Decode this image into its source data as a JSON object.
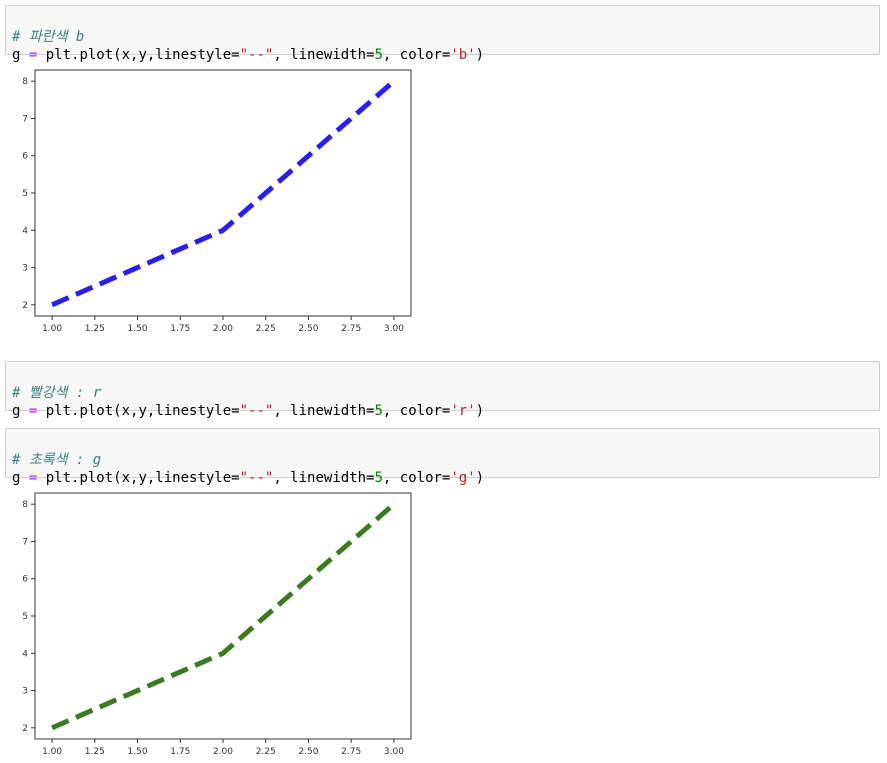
{
  "cells": [
    {
      "comment": "# 파란색 b",
      "code": {
        "var": "g",
        "assign": " = ",
        "call": "plt.plot(x,y,linestyle=",
        "linestyle_value": "\"--\"",
        "mid": ", linewidth=",
        "linewidth_value": "5",
        "mid2": ", color=",
        "color_value": "'b'",
        "end": ")"
      }
    },
    {
      "comment": "# 빨강색 : r",
      "code": {
        "var": "g",
        "assign": " = ",
        "call": "plt.plot(x,y,linestyle=",
        "linestyle_value": "\"--\"",
        "mid": ", linewidth=",
        "linewidth_value": "5",
        "mid2": ", color=",
        "color_value": "'r'",
        "end": ")"
      }
    },
    {
      "comment": "# 초록색 : g",
      "code": {
        "var": "g",
        "assign": " = ",
        "call": "plt.plot(x,y,linestyle=",
        "linestyle_value": "\"--\"",
        "mid": ", linewidth=",
        "linewidth_value": "5",
        "mid2": ", color=",
        "color_value": "'g'",
        "end": ")"
      }
    }
  ],
  "chart_data": [
    {
      "type": "line",
      "x": [
        1,
        2,
        3
      ],
      "y": [
        2,
        4,
        8
      ],
      "color": "#2a1df0",
      "linestyle": "dashed",
      "xlim": [
        0.9,
        3.1
      ],
      "ylim": [
        1.7,
        8.3
      ],
      "xticks": [
        1.0,
        1.25,
        1.5,
        1.75,
        2.0,
        2.25,
        2.5,
        2.75,
        3.0
      ],
      "xtick_labels": [
        "1.00",
        "1.25",
        "1.50",
        "1.75",
        "2.00",
        "2.25",
        "2.50",
        "2.75",
        "3.00"
      ],
      "yticks": [
        2,
        3,
        4,
        5,
        6,
        7,
        8
      ],
      "ytick_labels": [
        "2",
        "3",
        "4",
        "5",
        "6",
        "7",
        "8"
      ],
      "grid": false
    },
    {
      "type": "line",
      "x": [
        1,
        2,
        3
      ],
      "y": [
        2,
        4,
        8
      ],
      "color": "#3a7a21",
      "linestyle": "dashed",
      "xlim": [
        0.9,
        3.1
      ],
      "ylim": [
        1.7,
        8.3
      ],
      "xticks": [
        1.0,
        1.25,
        1.5,
        1.75,
        2.0,
        2.25,
        2.5,
        2.75,
        3.0
      ],
      "xtick_labels": [
        "1.00",
        "1.25",
        "1.50",
        "1.75",
        "2.00",
        "2.25",
        "2.50",
        "2.75",
        "3.00"
      ],
      "yticks": [
        2,
        3,
        4,
        5,
        6,
        7,
        8
      ],
      "ytick_labels": [
        "2",
        "3",
        "4",
        "5",
        "6",
        "7",
        "8"
      ],
      "grid": false
    }
  ]
}
